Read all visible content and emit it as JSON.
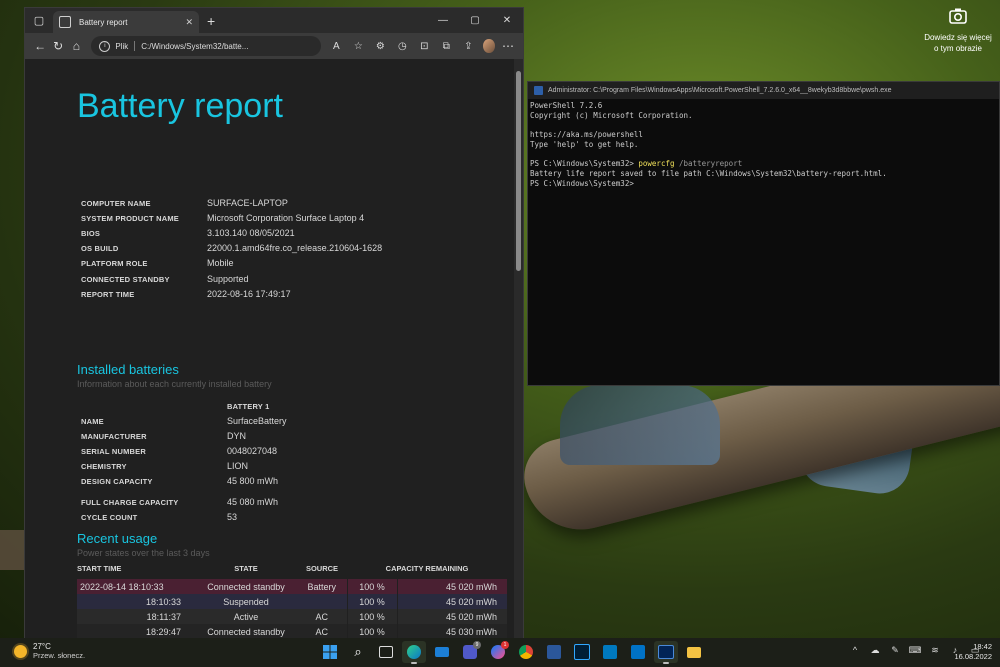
{
  "desktop": {
    "screenshot_hint_line1": "Dowiedz się więcej",
    "screenshot_hint_line2": "o tym obrazie"
  },
  "browser": {
    "tab_title": "Battery report",
    "address_prefix": "Plik",
    "address_url": "C:/Windows/System32/batte..."
  },
  "report": {
    "title": "Battery report",
    "system_info": [
      {
        "key": "COMPUTER NAME",
        "value": "SURFACE-LAPTOP"
      },
      {
        "key": "SYSTEM PRODUCT NAME",
        "value": "Microsoft Corporation Surface Laptop 4"
      },
      {
        "key": "BIOS",
        "value": "3.103.140 08/05/2021"
      },
      {
        "key": "OS BUILD",
        "value": "22000.1.amd64fre.co_release.210604-1628"
      },
      {
        "key": "PLATFORM ROLE",
        "value": "Mobile"
      },
      {
        "key": "CONNECTED STANDBY",
        "value": "Supported"
      },
      {
        "key": "REPORT TIME",
        "value": "2022-08-16  17:49:17"
      }
    ],
    "installed_batteries": {
      "heading": "Installed batteries",
      "subheading": "Information about each currently installed battery",
      "column": "BATTERY 1",
      "rows": [
        {
          "key": "NAME",
          "value": "SurfaceBattery"
        },
        {
          "key": "MANUFACTURER",
          "value": "DYN"
        },
        {
          "key": "SERIAL NUMBER",
          "value": "0048027048"
        },
        {
          "key": "CHEMISTRY",
          "value": "LION"
        },
        {
          "key": "DESIGN CAPACITY",
          "value": "45 800 mWh"
        },
        {
          "key": "FULL CHARGE CAPACITY",
          "value": "45 080 mWh"
        },
        {
          "key": "CYCLE COUNT",
          "value": "53"
        }
      ]
    },
    "recent_usage": {
      "heading": "Recent usage",
      "subheading": "Power states over the last 3 days",
      "headers": {
        "start_time": "START TIME",
        "state": "STATE",
        "source": "SOURCE",
        "capacity": "CAPACITY REMAINING"
      },
      "rows": [
        {
          "start": "2022-08-14   18:10:33",
          "state": "Connected standby",
          "source": "Battery",
          "pct": "100 %",
          "mwh": "45 020 mWh"
        },
        {
          "start": "18:10:33",
          "state": "Suspended",
          "source": "",
          "pct": "100 %",
          "mwh": "45 020 mWh"
        },
        {
          "start": "18:11:37",
          "state": "Active",
          "source": "AC",
          "pct": "100 %",
          "mwh": "45 020 mWh"
        },
        {
          "start": "18:29:47",
          "state": "Connected standby",
          "source": "AC",
          "pct": "100 %",
          "mwh": "45 030 mWh"
        }
      ]
    }
  },
  "terminal": {
    "title": "Administrator: C:\\Program Files\\WindowsApps\\Microsoft.PowerShell_7.2.6.0_x64__8wekyb3d8bbwe\\pwsh.exe",
    "lines": {
      "l1": "PowerShell 7.2.6",
      "l2": "Copyright (c) Microsoft Corporation.",
      "l3": "https://aka.ms/powershell",
      "l4": "Type 'help' to get help.",
      "prompt1": "PS C:\\Windows\\System32> ",
      "cmd": "powercfg",
      "arg": " /batteryreport",
      "l6": "Battery life report saved to file path C:\\Windows\\System32\\battery-report.html.",
      "prompt2": "PS C:\\Windows\\System32>"
    }
  },
  "taskbar": {
    "temperature": "27°C",
    "weather": "Przew. słonecz.",
    "time": "18:42",
    "date": "16.08.2022",
    "badge_teams": "9",
    "badge_messenger": "1"
  }
}
